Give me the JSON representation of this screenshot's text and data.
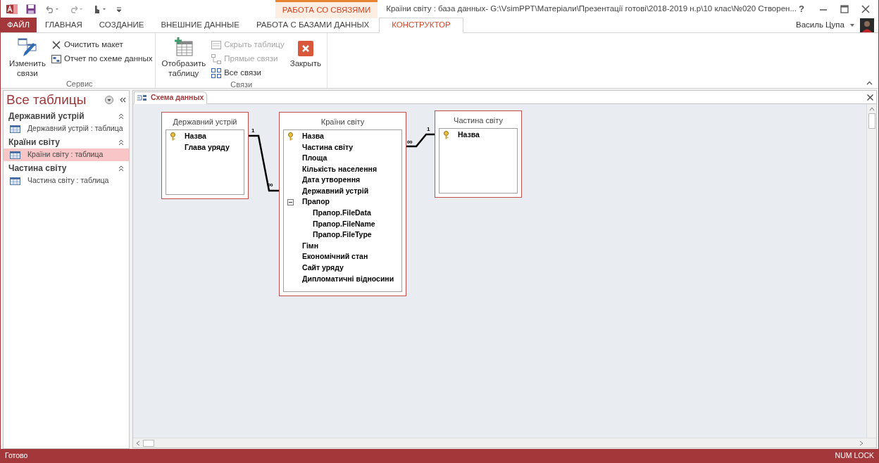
{
  "window": {
    "title": "Країни світу : база данных- G:\\VsimPPT\\Матеріали\\Презентації готові\\2018-2019 н.р\\10 клас\\№020 Створен...",
    "context_tab": "РАБОТА СО СВЯЗЯМИ",
    "help": "?",
    "user": "Василь Цупа"
  },
  "ribbon_tabs": [
    {
      "label": "ФАЙЛ",
      "kind": "file",
      "selected": false
    },
    {
      "label": "ГЛАВНАЯ",
      "kind": "tab",
      "selected": false
    },
    {
      "label": "СОЗДАНИЕ",
      "kind": "tab",
      "selected": false
    },
    {
      "label": "ВНЕШНИЕ ДАННЫЕ",
      "kind": "tab",
      "selected": false
    },
    {
      "label": "РАБОТА С БАЗАМИ ДАННЫХ",
      "kind": "tab",
      "selected": false
    },
    {
      "label": "КОНСТРУКТОР",
      "kind": "tab",
      "selected": true
    }
  ],
  "ribbon_groups": [
    {
      "label": "Сервис",
      "buttons": [
        {
          "kind": "large",
          "label": "Изменить связи",
          "disabled": false
        },
        {
          "kind": "small",
          "label": "Очистить макет",
          "disabled": false
        },
        {
          "kind": "small",
          "label": "Отчет по схеме данных",
          "disabled": false
        }
      ]
    },
    {
      "label": "Связи",
      "buttons": [
        {
          "kind": "large",
          "label": "Отобразить таблицу",
          "disabled": false
        },
        {
          "kind": "small",
          "label": "Скрыть таблицу",
          "disabled": true
        },
        {
          "kind": "small",
          "label": "Прямые связи",
          "disabled": true
        },
        {
          "kind": "small",
          "label": "Все связи",
          "disabled": false
        },
        {
          "kind": "large",
          "label": "Закрыть",
          "disabled": false
        }
      ]
    }
  ],
  "nav_pane": {
    "title": "Все таблицы",
    "groups": [
      {
        "label": "Державний устрій",
        "items": [
          {
            "label": "Державний устрій : таблица",
            "selected": false
          }
        ]
      },
      {
        "label": "Країни світу",
        "items": [
          {
            "label": "Країни світу : таблица",
            "selected": true
          }
        ]
      },
      {
        "label": "Частина світу",
        "items": [
          {
            "label": "Частина світу : таблица",
            "selected": false
          }
        ]
      }
    ]
  },
  "document_tab": {
    "label": "Схема данных"
  },
  "diagram": {
    "tables": [
      {
        "name": "Державний устрій",
        "fields": [
          {
            "name": "Назва",
            "primary_key": true
          },
          {
            "name": "Глава уряду",
            "primary_key": false
          }
        ]
      },
      {
        "name": "Країни світу",
        "fields": [
          {
            "name": "Назва",
            "primary_key": true
          },
          {
            "name": "Частина світу",
            "primary_key": false
          },
          {
            "name": "Площа",
            "primary_key": false
          },
          {
            "name": "Кількість населення",
            "primary_key": false
          },
          {
            "name": "Дата утворення",
            "primary_key": false
          },
          {
            "name": "Державний устрій",
            "primary_key": false
          },
          {
            "name": "Прапор",
            "primary_key": false,
            "expanded": true,
            "children": [
              {
                "name": "Прапор.FileData"
              },
              {
                "name": "Прапор.FileName"
              },
              {
                "name": "Прапор.FileType"
              }
            ]
          },
          {
            "name": "Гімн",
            "primary_key": false
          },
          {
            "name": "Економічний стан",
            "primary_key": false
          },
          {
            "name": "Сайт уряду",
            "primary_key": false
          },
          {
            "name": "Дипломатичні відносини",
            "primary_key": false
          }
        ]
      },
      {
        "name": "Частина світу",
        "fields": [
          {
            "name": "Назва",
            "primary_key": true
          }
        ]
      }
    ],
    "relationships": [
      {
        "one_label": "1",
        "many_label": "∞"
      },
      {
        "one_label": "1",
        "many_label": "∞"
      }
    ]
  },
  "status_bar": {
    "left": "Готово",
    "right": "NUM LOCK"
  }
}
